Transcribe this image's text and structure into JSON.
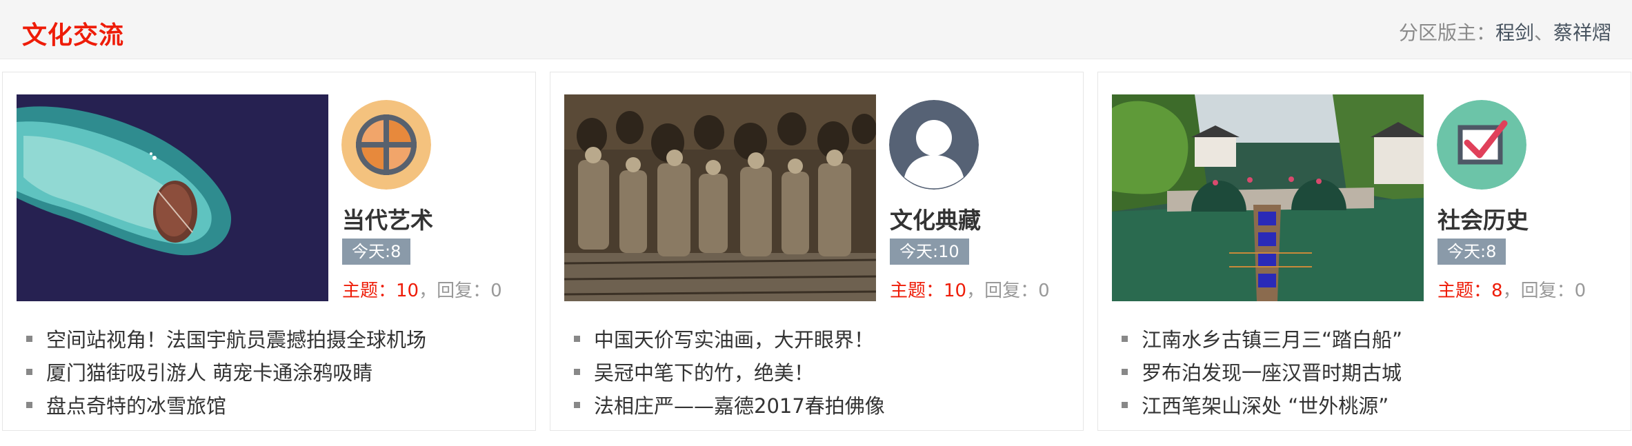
{
  "section": {
    "title": "文化交流",
    "moderators_label": "分区版主：",
    "moderators": [
      "程剑",
      "蔡祥熠"
    ],
    "moderator_separator": "、"
  },
  "colors": {
    "accent": "#ee1c08",
    "badge": "#8a9aa9",
    "header_bg": "#f5f5f5",
    "moderator_link": "#47535f"
  },
  "forums": [
    {
      "name": "当代艺术",
      "icon": "compass-crosshair-icon",
      "icon_bg": "#f4c27e",
      "today": "今天:8",
      "topics_label": "主题：10",
      "replies_label": "回复：0",
      "posts": [
        "空间站视角！法国宇航员震撼拍摄全球机场",
        "厦门猫街吸引游人 萌宠卡通涂鸦吸睛",
        "盘点奇特的冰雪旅馆"
      ]
    },
    {
      "name": "文化典藏",
      "icon": "user-silhouette-icon",
      "icon_bg": "#566275",
      "today": "今天:10",
      "topics_label": "主题：10",
      "replies_label": "回复：0",
      "posts": [
        "中国天价写实油画，大开眼界！",
        "吴冠中笔下的竹，绝美！",
        "法相庄严——嘉德2017春拍佛像"
      ]
    },
    {
      "name": "社会历史",
      "icon": "checkbox-checked-icon",
      "icon_bg": "#6cc4a8",
      "today": "今天:8",
      "topics_label": "主题：8",
      "replies_label": "回复：0",
      "posts": [
        "江南水乡古镇三月三“踏白船”",
        "罗布泊发现一座汉晋时期古城",
        "江西笔架山深处 “世外桃源”"
      ]
    }
  ]
}
